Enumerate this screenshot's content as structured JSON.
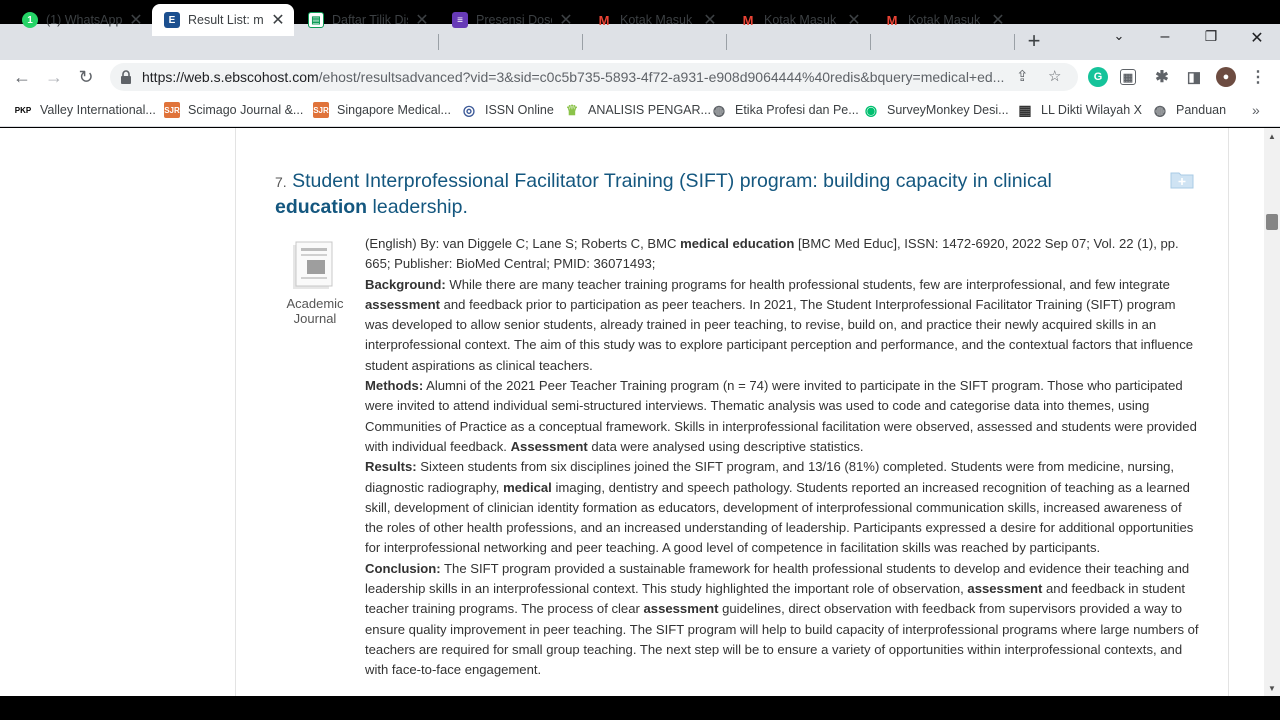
{
  "browser": {
    "tabs": [
      {
        "title": "(1) WhatsApp",
        "icon": "whatsapp-icon",
        "color": "#25d366",
        "glyph": "1"
      },
      {
        "title": "Result List: me",
        "icon": "ebsco-icon",
        "color": "#1b4f8f",
        "glyph": "E"
      },
      {
        "title": "Daftar Tilik Dis",
        "icon": "sheets-icon",
        "color": "#0f9d58",
        "glyph": "▤"
      },
      {
        "title": "Presensi Doser",
        "icon": "forms-icon",
        "color": "#673ab7",
        "glyph": "≡"
      },
      {
        "title": "Kotak Masuk (",
        "icon": "gmail-icon",
        "color": "#ffffff",
        "glyph": "M"
      },
      {
        "title": "Kotak Masuk (",
        "icon": "gmail-icon",
        "color": "#ffffff",
        "glyph": "M"
      },
      {
        "title": "Kotak Masuk (",
        "icon": "gmail-icon",
        "color": "#ffffff",
        "glyph": "M"
      }
    ],
    "url_host": "https://web.s.ebscohost.com",
    "url_rest": "/ehost/resultsadvanced?vid=3&sid=c0c5b735-5893-4f72-a931-e908d9064444%40redis&bquery=medical+ed...",
    "bookmarks": [
      {
        "label": "Valley International...",
        "icon": "pkp-icon",
        "badge": "PKP",
        "color": "#000000"
      },
      {
        "label": "Scimago Journal &...",
        "icon": "sjr-icon",
        "badge": "SJR",
        "color": "#e0733a"
      },
      {
        "label": "Singapore Medical...",
        "icon": "sjr-icon",
        "badge": "SJR",
        "color": "#e0733a"
      },
      {
        "label": "ISSN Online",
        "icon": "globe-icon",
        "badge": "◎",
        "color": "#3d5a98"
      },
      {
        "label": "ANALISIS PENGAR...",
        "icon": "crown-icon",
        "badge": "♛",
        "color": "#8bc34a"
      },
      {
        "label": "Etika Profesi dan Pe...",
        "icon": "web-icon",
        "badge": "◍",
        "color": "#5f6368"
      },
      {
        "label": "SurveyMonkey Desi...",
        "icon": "surveymonkey-icon",
        "badge": "◉",
        "color": "#00bf6f"
      },
      {
        "label": "LL Dikti Wilayah X",
        "icon": "building-icon",
        "badge": "▦",
        "color": "#333333"
      },
      {
        "label": "Panduan",
        "icon": "web-icon",
        "badge": "◍",
        "color": "#5f6368"
      }
    ]
  },
  "result": {
    "number": "7.",
    "title_a": "Student Interprofessional Facilitator Training (SIFT) program: building capacity in clinical",
    "title_hi": "education",
    "title_b": " leadership.",
    "pub_type_line1": "Academic",
    "pub_type_line2": "Journal",
    "citation_pre": "(English) By: van Diggele C; Lane S; Roberts C, BMC ",
    "citation_hi": "medical education",
    "citation_post": " [BMC Med Educ], ISSN: 1472-6920, 2022 Sep 07; Vol. 22 (1), pp. 665; Publisher: BioMed Central; PMID: 36071493;",
    "background_label": "Background:",
    "background_1": " While there are many teacher training programs for health professional students, few are interprofessional, and few integrate ",
    "background_hi": "assessment",
    "background_2": " and feedback prior to participation as peer teachers. In 2021, The Student Interprofessional Facilitator Training (SIFT) program was developed to allow senior students, already trained in peer teaching, to revise, build on, and practice their newly acquired skills in an interprofessional context. The aim of this study was to explore participant perception and performance, and the contextual factors that influence student aspirations as clinical teachers.",
    "methods_label": "Methods:",
    "methods_1": " Alumni of the 2021 Peer Teacher Training program (n = 74) were invited to participate in the SIFT program. Those who participated were invited to attend individual semi-structured interviews. Thematic analysis was used to code and categorise data into themes, using Communities of Practice as a conceptual framework. Skills in interprofessional facilitation were observed, assessed and students were provided with individual feedback. ",
    "methods_hi": "Assessment",
    "methods_2": " data were analysed using descriptive statistics.",
    "results_label": "Results:",
    "results_1": " Sixteen students from six disciplines joined the SIFT program, and 13/16 (81%) completed. Students were from medicine, nursing, diagnostic radiography, ",
    "results_hi": "medical",
    "results_2": " imaging, dentistry and speech pathology. Students reported an increased recognition of teaching as a learned skill, development of clinician identity formation as educators, development of interprofessional communication skills, increased awareness of the roles of other health professions, and an increased understanding of leadership. Participants expressed a desire for additional opportunities for interprofessional networking and peer teaching. A good level of competence in facilitation skills was reached by participants.",
    "conclusion_label": "Conclusion:",
    "conclusion_1": " The SIFT program provided a sustainable framework for health professional students to develop and evidence their teaching and leadership skills in an interprofessional context. This study highlighted the important role of observation, ",
    "conclusion_hi1": "assessment",
    "conclusion_2": " and feedback in student teacher training programs. The process of clear ",
    "conclusion_hi2": "assessment",
    "conclusion_3": " guidelines, direct observation with feedback from supervisors provided a way to ensure quality improvement in peer teaching. The SIFT program will help to build capacity of interprofessional programs where large numbers of teachers are required for small group teaching. The next step will be to ensure a variety of opportunities within interprofessional contexts, and with face-to-face engagement."
  },
  "colors": {
    "title_link": "#14577f",
    "tab_strip": "#dee1e6",
    "accent_folder": "#b9d7ec"
  }
}
